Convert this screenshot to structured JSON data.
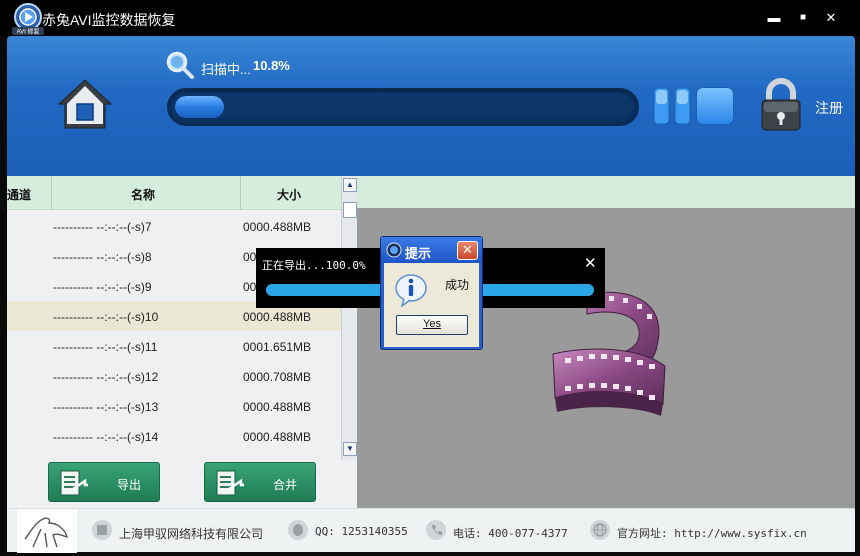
{
  "window": {
    "title": "赤兔AVI监控数据恢复",
    "logo_text": "AVI 修复",
    "controls": {
      "minimize": "▬",
      "maximize": "■",
      "close": "✕"
    }
  },
  "header": {
    "scan_label": "扫描中...",
    "scan_percent": "10.8%",
    "scan_progress_fraction": 0.108,
    "register_label": "注册",
    "icons": [
      "home-icon",
      "magnifier-icon",
      "pause-icon",
      "stop-icon",
      "lock-icon"
    ]
  },
  "list": {
    "columns": [
      "通道",
      "名称",
      "大小"
    ],
    "selected_index": 3,
    "rows": [
      {
        "name": "---------- --:--:--(-s)7",
        "size": "0000.488MB"
      },
      {
        "name": "---------- --:--:--(-s)8",
        "size": "0000.488MB"
      },
      {
        "name": "---------- --:--:--(-s)9",
        "size": "0000.488MB"
      },
      {
        "name": "---------- --:--:--(-s)10",
        "size": "0000.488MB"
      },
      {
        "name": "---------- --:--:--(-s)11",
        "size": "0001.651MB"
      },
      {
        "name": "---------- --:--:--(-s)12",
        "size": "0000.708MB"
      },
      {
        "name": "---------- --:--:--(-s)13",
        "size": "0000.488MB"
      },
      {
        "name": "---------- --:--:--(-s)14",
        "size": "0000.488MB"
      }
    ],
    "buttons": {
      "export": "导出",
      "merge": "合并"
    }
  },
  "export_progress": {
    "text": "正在导出...100.0%",
    "progress_fraction": 1.0,
    "close": "✕"
  },
  "dialog": {
    "title": "提示",
    "message": "成功",
    "yes_label": "Yes",
    "close": "✕"
  },
  "footer": {
    "company": "上海甲驭网络科技有限公司",
    "qq": "QQ: 1253140355",
    "phone": "电话: 400-077-4377",
    "website": "官方网址: http://www.sysfix.cn"
  },
  "colors": {
    "header_blue": "#2169c3",
    "list_header_green": "#d5eddc",
    "action_green": "#2a8f63",
    "selected_row": "#ebe7d5",
    "export_bar_fill": "#2aa6e6"
  }
}
